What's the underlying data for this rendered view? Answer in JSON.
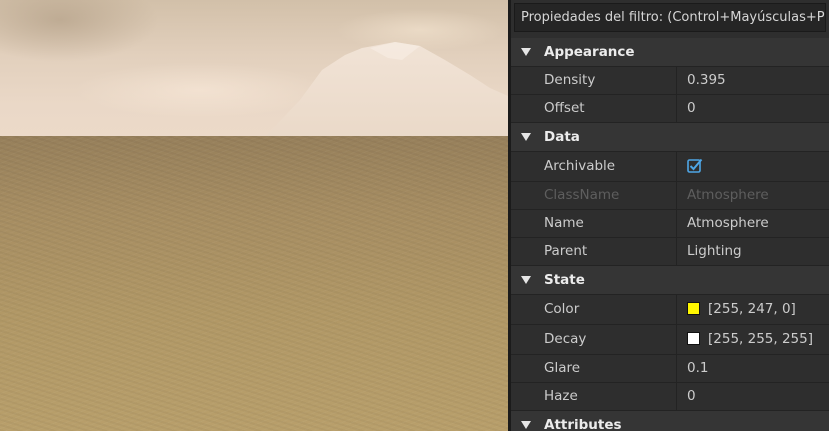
{
  "viewport": {
    "sky_color": "#e8d6c4",
    "ground_color": "#b09763"
  },
  "panel": {
    "filter_text": "Propiedades del filtro: (Control+Mayúsculas+P)",
    "sections": {
      "appearance": {
        "label": "Appearance",
        "density": {
          "name": "Density",
          "value": "0.395"
        },
        "offset": {
          "name": "Offset",
          "value": "0"
        }
      },
      "data": {
        "label": "Data",
        "archivable": {
          "name": "Archivable",
          "checked": true,
          "icon": "checkbox-checked-icon"
        },
        "classname": {
          "name": "ClassName",
          "value": "Atmosphere"
        },
        "name": {
          "name": "Name",
          "value": "Atmosphere"
        },
        "parent": {
          "name": "Parent",
          "value": "Lighting"
        }
      },
      "state": {
        "label": "State",
        "color": {
          "name": "Color",
          "value": "[255, 247, 0]",
          "swatch": "#fff700"
        },
        "decay": {
          "name": "Decay",
          "value": "[255, 255, 255]",
          "swatch": "#ffffff"
        },
        "glare": {
          "name": "Glare",
          "value": "0.1"
        },
        "haze": {
          "name": "Haze",
          "value": "0"
        }
      },
      "attributes": {
        "label": "Attributes"
      }
    }
  }
}
